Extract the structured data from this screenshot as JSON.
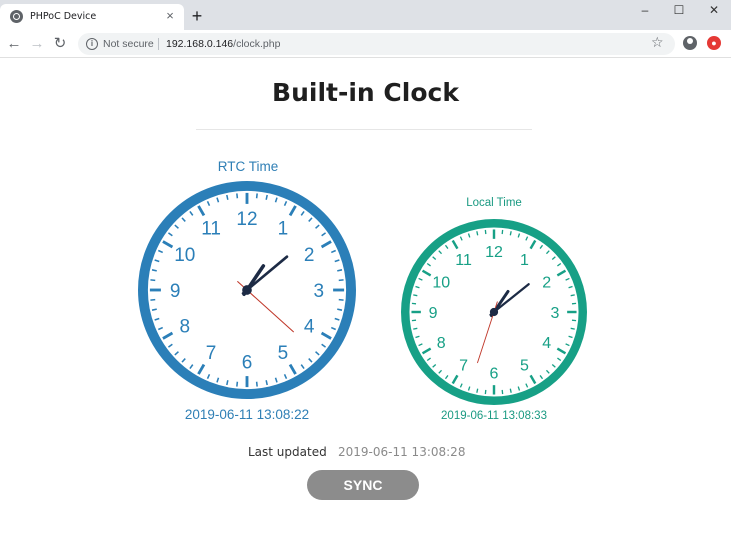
{
  "browser": {
    "tab_title": "PHPoC Device",
    "tab_close": "×",
    "new_tab": "+",
    "window_controls": {
      "minimize": "–",
      "maximize": "☐",
      "close": "✕"
    },
    "nav": {
      "back": "←",
      "forward": "→",
      "reload": "↻"
    },
    "security_label": "Not secure",
    "url_host": "192.168.0.146",
    "url_path": "/clock.php",
    "icons": [
      "page-favicon-icon",
      "info-icon",
      "star-icon",
      "profile-icon",
      "extension-icon"
    ]
  },
  "page": {
    "title": "Built-in Clock",
    "rtc": {
      "label": "RTC Time",
      "datetime": "2019-06-11 13:08:22",
      "hours": 13,
      "minutes": 8,
      "seconds": 22,
      "color": "#2b7fb8"
    },
    "local": {
      "label": "Local Time",
      "datetime": "2019-06-11 13:08:33",
      "hours": 13,
      "minutes": 8,
      "seconds": 33,
      "color": "#17a086"
    },
    "clock_numerals": [
      "12",
      "1",
      "2",
      "3",
      "4",
      "5",
      "6",
      "7",
      "8",
      "9",
      "10",
      "11"
    ],
    "last_updated_label": "Last updated",
    "last_updated_value": "2019-06-11 13:08:28",
    "sync_label": "SYNC"
  },
  "colors": {
    "hand": "#1d2b45",
    "second_hand": "#c0392b",
    "sync_button": "#8c8c8c"
  }
}
